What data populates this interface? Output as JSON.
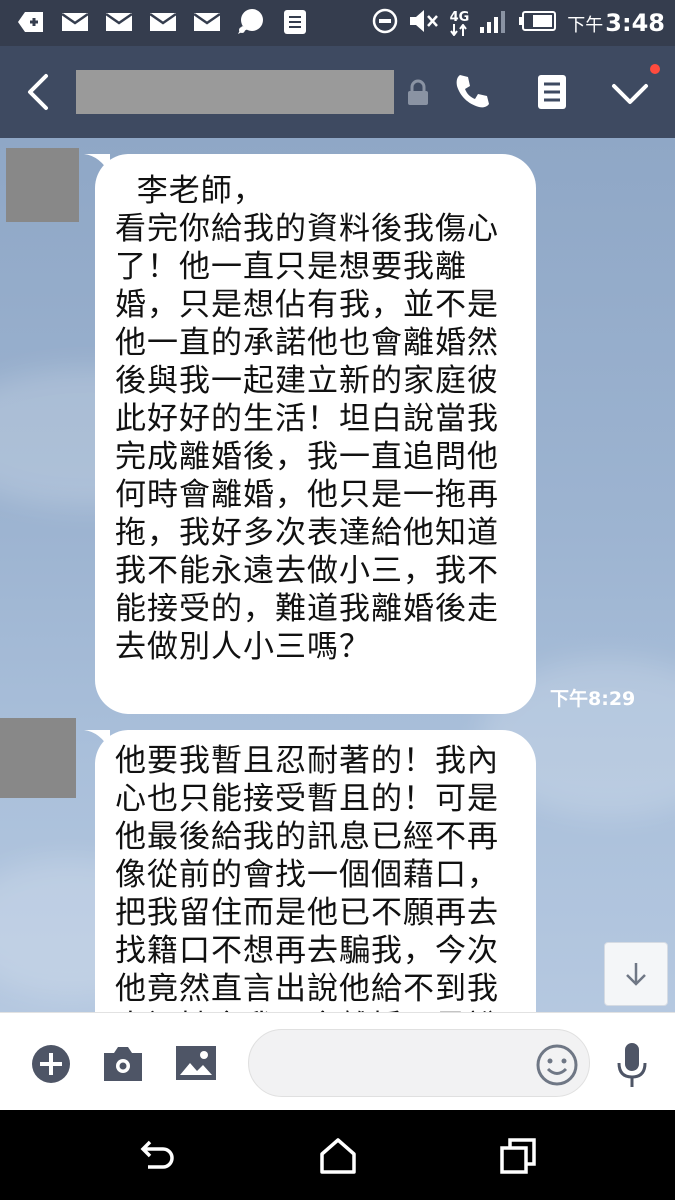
{
  "status_bar": {
    "ampm": "下午",
    "time": "3:48",
    "network": "4G"
  },
  "header": {
    "icons": [
      "back-icon",
      "lock-icon",
      "phone-icon",
      "notes-icon",
      "chevron-down-icon"
    ]
  },
  "messages": [
    {
      "text": "  李老師，\n看完你給我的資料後我傷心\n了！他一直只是想要我離\n婚，只是想佔有我，並不是\n他一直的承諾他也會離婚然\n後與我一起建立新的家庭彼\n此好好的生活！坦白說當我\n完成離婚後，我一直追問他\n何時會離婚，他只是一拖再\n拖，我好多次表達給他知道\n我不能永遠去做小三，我不\n能接受的，難道我離婚後走\n去做別人小三嗎？",
      "time": "下午8:29"
    },
    {
      "text": "他要我暫且忍耐著的！我內\n心也只能接受暫且的！可是\n他最後給我的訊息已經不再\n像從前的會找一個個藉口，\n把我留住而是他已不願再去\n找籍口不想再去騙我，今次\n他竟然直言出說他給不到我\n幸福她會我不會離婚而是說",
      "time": ""
    }
  ],
  "input_bar": {
    "placeholder": "",
    "icons": [
      "plus-icon",
      "camera-icon",
      "image-icon",
      "emoji-icon",
      "mic-icon"
    ]
  },
  "nav_bar": {
    "icons": [
      "back-nav-icon",
      "home-icon",
      "recents-icon"
    ]
  },
  "colors": {
    "status_bar_bg": "#353d4e",
    "header_bg": "#3e4a61",
    "chat_bg": "#9db4d1",
    "bubble_bg": "#ffffff",
    "notification_dot": "#ff4b3e"
  }
}
